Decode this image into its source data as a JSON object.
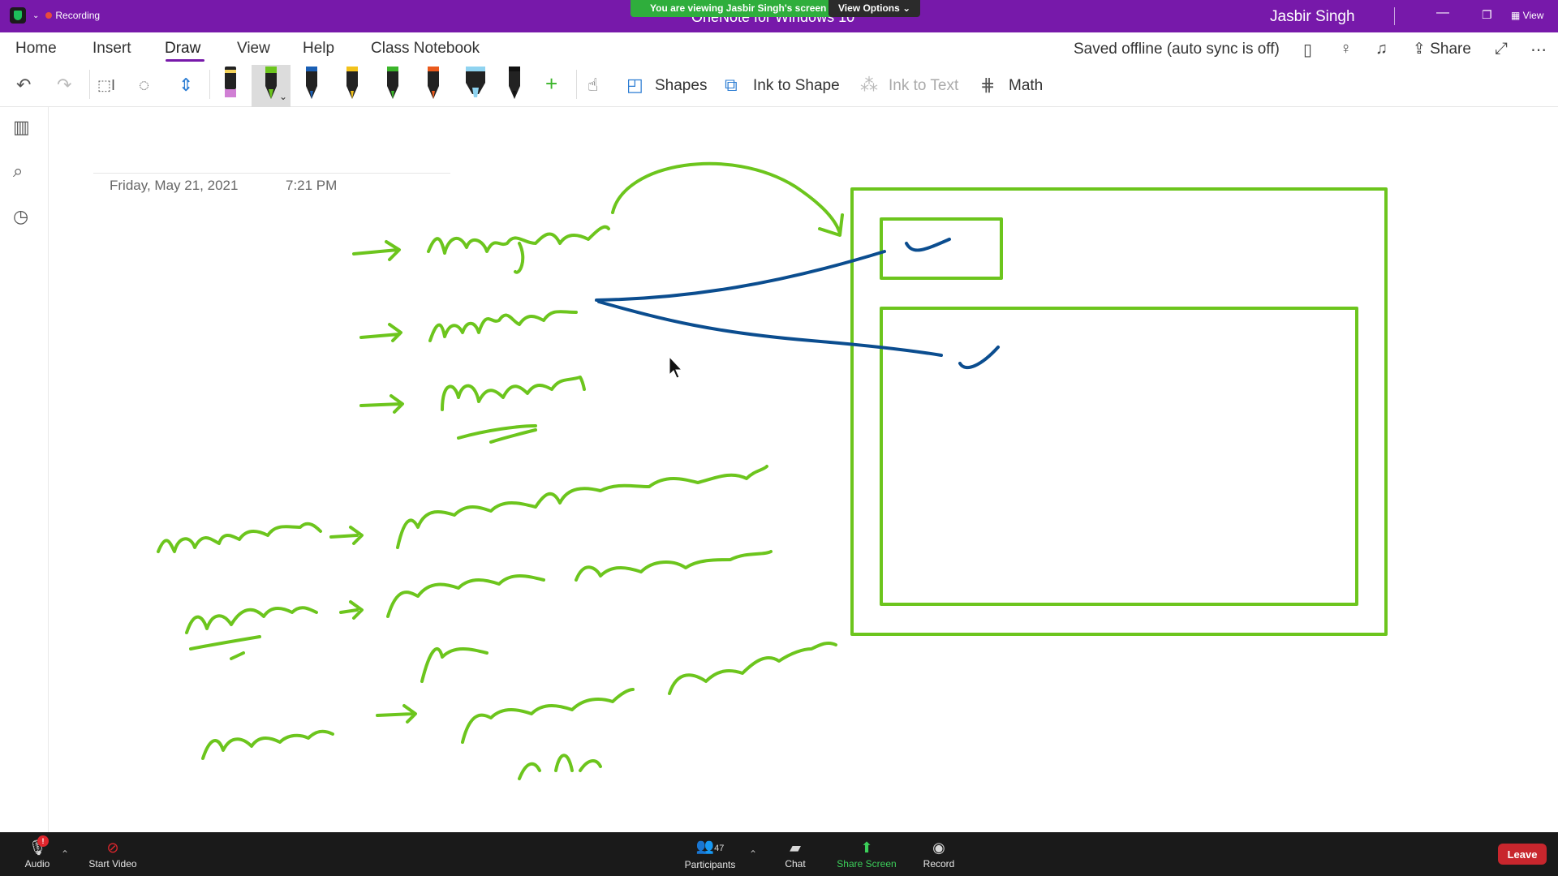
{
  "titlebar": {
    "recording_label": "Recording",
    "app_title": "OneNote for Windows 10",
    "viewing_banner": "You are viewing Jasbir Singh's screen",
    "view_options": "View Options ⌄",
    "user_name": "Jasbir Singh",
    "view_button": "View"
  },
  "ribbon": {
    "tabs": [
      "Home",
      "Insert",
      "Draw",
      "View",
      "Help",
      "Class Notebook"
    ],
    "active_tab": "Draw",
    "status": "Saved offline (auto sync is off)",
    "share_label": "Share"
  },
  "toolbar": {
    "shapes_label": "Shapes",
    "ink_to_shape_label": "Ink to Shape",
    "ink_to_text_label": "Ink to Text",
    "math_label": "Math",
    "pens": [
      {
        "name": "highlighter-pink",
        "color": "#d07fd4"
      },
      {
        "name": "pen-green-selected",
        "color": "#6cc51d"
      },
      {
        "name": "pen-blue",
        "color": "#1a5fb4"
      },
      {
        "name": "pen-yellow",
        "color": "#f2c21b"
      },
      {
        "name": "pen-green",
        "color": "#3bb52a"
      },
      {
        "name": "pen-orange",
        "color": "#ea5a1d"
      },
      {
        "name": "highlighter-blue",
        "color": "#8fd3f0"
      },
      {
        "name": "pen-black",
        "color": "#111111"
      }
    ]
  },
  "page": {
    "date": "Friday, May 21, 2021",
    "time": "7:21 PM"
  },
  "ink_colors": {
    "green": "#6cc51d",
    "blue": "#0b4d8f"
  },
  "bottombar": {
    "audio": "Audio",
    "audio_badge": "!",
    "start_video": "Start Video",
    "participants": "Participants",
    "participant_count": "47",
    "chat": "Chat",
    "share_screen": "Share Screen",
    "record": "Record",
    "leave": "Leave"
  }
}
